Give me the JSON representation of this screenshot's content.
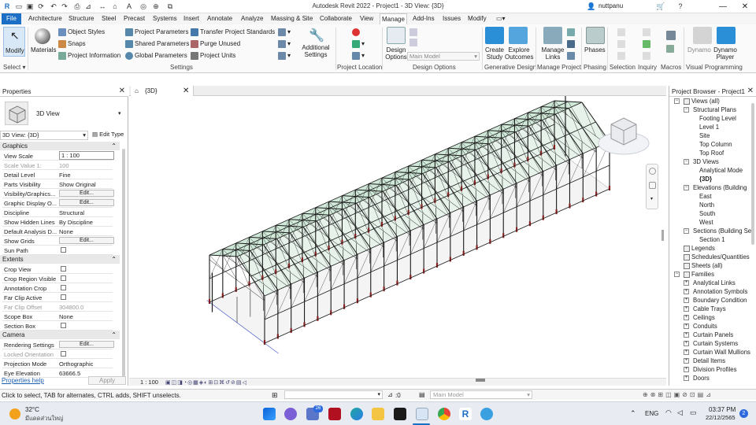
{
  "app": {
    "title": "Autodesk Revit 2022 - Project1 - 3D View: {3D}",
    "user": "nuttpanu"
  },
  "tabs": [
    "File",
    "Architecture",
    "Structure",
    "Steel",
    "Precast",
    "Systems",
    "Insert",
    "Annotate",
    "Analyze",
    "Massing & Site",
    "Collaborate",
    "View",
    "Manage",
    "Add-Ins",
    "Issues",
    "Modify"
  ],
  "active_tab": "Manage",
  "ribbon": {
    "modify": "Modify",
    "select": "Select ▾",
    "materials": "Materials",
    "settings_items": [
      "Object Styles",
      "Snaps",
      "Project Information",
      "Project Parameters",
      "Shared Parameters",
      "Global Parameters",
      "Transfer Project Standards",
      "Purge Unused",
      "Project Units"
    ],
    "additional_settings": "Additional Settings",
    "settings_label": "Settings",
    "project_location_label": "Project Location",
    "design_options": "Design Options",
    "design_options_label": "Design Options",
    "main_model": "Main Model",
    "create_study": "Create Study",
    "explore_outcomes": "Explore Outcomes",
    "generative_design_label": "Generative Design",
    "manage_links": "Manage Links",
    "manage_project_label": "Manage Project",
    "phases": "Phases",
    "phasing_label": "Phasing",
    "selection_label": "Selection",
    "inquiry_label": "Inquiry",
    "macros_label": "Macros",
    "dynamo": "Dynamo",
    "dynamo_player": "Dynamo Player",
    "visual_programming_label": "Visual Programming"
  },
  "properties": {
    "title": "Properties",
    "type_name": "3D View",
    "view_selector": "3D View: {3D}",
    "edit_type": "Edit Type",
    "groups": {
      "graphics": "Graphics",
      "extents": "Extents",
      "camera": "Camera"
    },
    "graphics_rows": [
      {
        "k": "View Scale",
        "v": "1 : 100"
      },
      {
        "k": "Scale Value    1:",
        "v": "100"
      },
      {
        "k": "Detail Level",
        "v": "Fine"
      },
      {
        "k": "Parts Visibility",
        "v": "Show Original"
      },
      {
        "k": "Visibility/Graphics...",
        "v": "Edit..."
      },
      {
        "k": "Graphic Display O...",
        "v": "Edit..."
      },
      {
        "k": "Discipline",
        "v": "Structural"
      },
      {
        "k": "Show Hidden Lines",
        "v": "By Discipline"
      },
      {
        "k": "Default Analysis D...",
        "v": "None"
      },
      {
        "k": "Show Grids",
        "v": "Edit..."
      },
      {
        "k": "Sun Path",
        "v": ""
      }
    ],
    "extents_rows": [
      {
        "k": "Crop View",
        "v": ""
      },
      {
        "k": "Crop Region Visible",
        "v": ""
      },
      {
        "k": "Annotation Crop",
        "v": ""
      },
      {
        "k": "Far Clip Active",
        "v": ""
      },
      {
        "k": "Far Clip Offset",
        "v": "304800.0"
      },
      {
        "k": "Scope Box",
        "v": "None"
      },
      {
        "k": "Section Box",
        "v": ""
      }
    ],
    "camera_rows": [
      {
        "k": "Rendering Settings",
        "v": "Edit..."
      },
      {
        "k": "Locked Orientation",
        "v": ""
      },
      {
        "k": "Projection Mode",
        "v": "Orthographic"
      },
      {
        "k": "Eye Elevation",
        "v": "63666.5"
      }
    ],
    "help": "Properties help",
    "apply": "Apply"
  },
  "view": {
    "tab_title": "{3D}",
    "scale": "1 : 100"
  },
  "browser": {
    "title": "Project Browser - Project1",
    "items": [
      {
        "label": "Views (all)",
        "level": 0
      },
      {
        "label": "Structural Plans",
        "level": 1
      },
      {
        "label": "Footing Level",
        "level": 2
      },
      {
        "label": "Level 1",
        "level": 2
      },
      {
        "label": "Site",
        "level": 2
      },
      {
        "label": "Top Column",
        "level": 2
      },
      {
        "label": "Top Roof",
        "level": 2
      },
      {
        "label": "3D Views",
        "level": 1
      },
      {
        "label": "Analytical Mode",
        "level": 2
      },
      {
        "label": "{3D}",
        "level": 2
      },
      {
        "label": "Elevations (Building",
        "level": 1
      },
      {
        "label": "East",
        "level": 2
      },
      {
        "label": "North",
        "level": 2
      },
      {
        "label": "South",
        "level": 2
      },
      {
        "label": "West",
        "level": 2
      },
      {
        "label": "Sections (Building Se",
        "level": 1
      },
      {
        "label": "Section 1",
        "level": 2
      },
      {
        "label": "Legends",
        "level": 0
      },
      {
        "label": "Schedules/Quantities",
        "level": 0
      },
      {
        "label": "Sheets (all)",
        "level": 0
      },
      {
        "label": "Families",
        "level": 0
      },
      {
        "label": "Analytical Links",
        "level": 1
      },
      {
        "label": "Annotation Symbols",
        "level": 1
      },
      {
        "label": "Boundary Condition",
        "level": 1
      },
      {
        "label": "Cable Trays",
        "level": 1
      },
      {
        "label": "Ceilings",
        "level": 1
      },
      {
        "label": "Conduits",
        "level": 1
      },
      {
        "label": "Curtain Panels",
        "level": 1
      },
      {
        "label": "Curtain Systems",
        "level": 1
      },
      {
        "label": "Curtain Wall Mullions",
        "level": 1
      },
      {
        "label": "Detail Items",
        "level": 1
      },
      {
        "label": "Division Profiles",
        "level": 1
      },
      {
        "label": "Doors",
        "level": 1
      }
    ]
  },
  "status": {
    "hint": "Click to select, TAB for alternates, CTRL adds, SHIFT unselects.",
    "zero": ":0",
    "model": "Main Model"
  },
  "taskbar": {
    "temp": "32°C",
    "weather": "มีแดดส่วนใหญ่",
    "lang": "ENG",
    "time": "03:37 PM",
    "date": "22/12/2565",
    "badge": "26",
    "notif": "2"
  },
  "colors": {
    "accent": "#1d6fc6",
    "steel": "#1a1a1a",
    "glass": "#cfe8d8"
  }
}
